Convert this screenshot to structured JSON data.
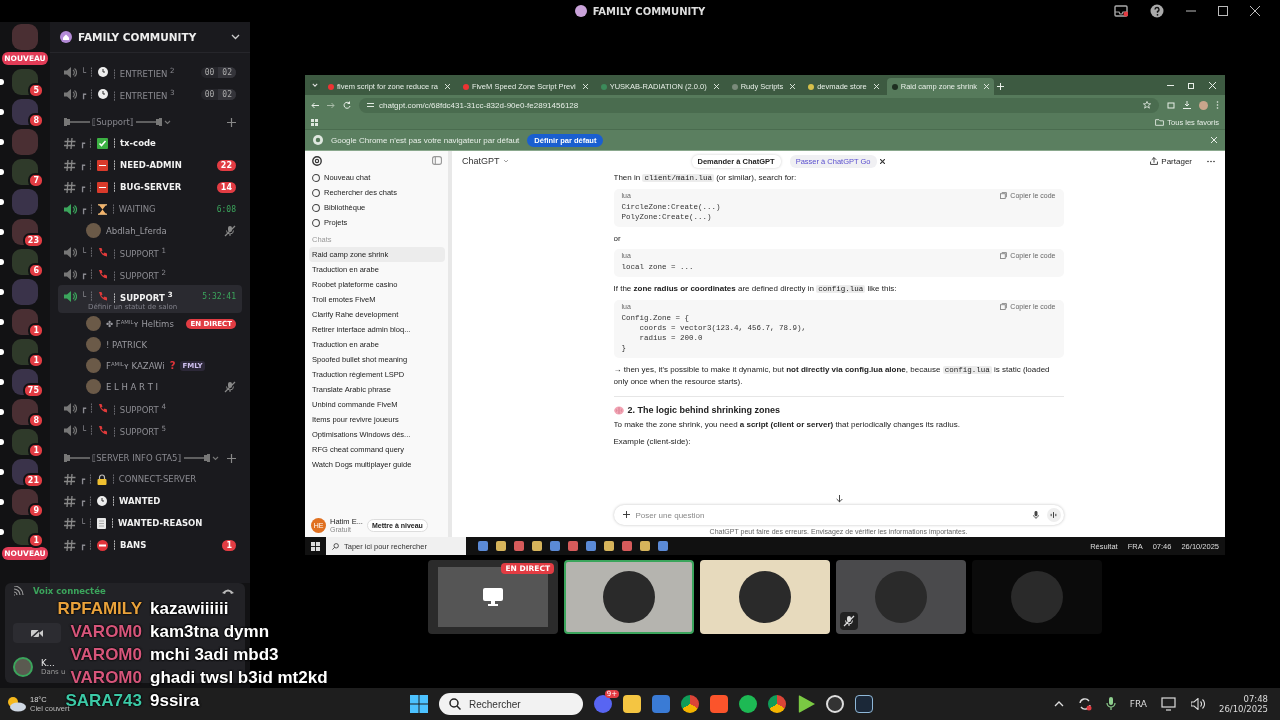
{
  "top_bar": {
    "title": "FAMILY COMMUNITY"
  },
  "servers": [
    {
      "unread": false,
      "pill": "NOUVEAU"
    },
    {
      "unread": true,
      "badge": "5"
    },
    {
      "unread": true,
      "badge": "8"
    },
    {
      "unread": true
    },
    {
      "unread": true,
      "badge": "7"
    },
    {
      "unread": true
    },
    {
      "unread": true,
      "badge": "23"
    },
    {
      "unread": true,
      "badge": "6"
    },
    {
      "unread": true
    },
    {
      "unread": true,
      "badge": "1"
    },
    {
      "unread": true,
      "badge": "1"
    },
    {
      "unread": true,
      "badge": "75"
    },
    {
      "unread": true,
      "badge": "8"
    },
    {
      "unread": true,
      "badge": "1"
    },
    {
      "unread": true,
      "badge": "21"
    },
    {
      "unread": true,
      "badge": "9"
    },
    {
      "unread": true,
      "badge": "1",
      "pill": "NOUVEAU"
    }
  ],
  "server_name": "FAMILY COMMUNITY",
  "channels": [
    {
      "kind": "voice",
      "prefix": "└ ┊",
      "name": "┊ ENTRETIEN $^{2}$",
      "active": false,
      "selected": false,
      "timer": [
        "00",
        "02"
      ]
    },
    {
      "kind": "voice",
      "prefix": "┏ ┊",
      "name": "┊ ENTRETIEN $^{3}$",
      "active": false,
      "selected": false,
      "timer": [
        "00",
        "02"
      ]
    },
    {
      "kind": "category",
      "name": "⟦Support⟧",
      "expanded": true
    },
    {
      "kind": "text",
      "prefix": "┏ ┊",
      "name": "┊ tx-code",
      "unread": true,
      "selected": false
    },
    {
      "kind": "text",
      "prefix": "┏ ┊",
      "name": "┊ NEED-ADMIN",
      "unread": true,
      "selected": false,
      "badge": "22"
    },
    {
      "kind": "text",
      "prefix": "┏ ┊",
      "name": "┊ BUG-SERVER",
      "unread": true,
      "selected": false,
      "badge": "14"
    },
    {
      "kind": "voice",
      "prefix": "┏ ┊",
      "name": "┊ WAITING",
      "active": true,
      "selected": false,
      "time": "6:08"
    },
    {
      "kind": "member",
      "name": "Abdlah_Lferda",
      "muted": true
    },
    {
      "kind": "voice",
      "prefix": "└ ┊",
      "name": "┊ SUPPORT $^{1}$",
      "active": false,
      "selected": false
    },
    {
      "kind": "voice",
      "prefix": "┏ ┊",
      "name": "┊ SUPPORT $^{2}$",
      "active": false,
      "selected": false
    },
    {
      "kind": "voice",
      "prefix": "└ ┊",
      "name": "┊ SUPPORT $^{3}$",
      "active": true,
      "selected": true,
      "time": "5:32:41",
      "status": "Définir un statut de salon"
    },
    {
      "kind": "member",
      "name": "✤ Fᴬᴹᴵᴸʏ Heltims",
      "muted": false,
      "live": "EN DIRECT"
    },
    {
      "kind": "member",
      "name": "! PATRICK",
      "muted": false
    },
    {
      "kind": "member",
      "name": "Fᴬᴹᴵᴸʏ KAZAWi",
      "mark": "?",
      "tag": "FMLY",
      "muted": false
    },
    {
      "kind": "member",
      "name": "E L H A R T I",
      "muted": true
    },
    {
      "kind": "voice",
      "prefix": "┏ ┊",
      "name": "┊ SUPPORT $^{4}$",
      "active": false,
      "selected": false
    },
    {
      "kind": "voice",
      "prefix": "└ ┊",
      "name": "┊ SUPPORT $^{5}$",
      "active": false,
      "selected": false
    },
    {
      "kind": "category",
      "name": "⟦SERVER INFO GTA5⟧",
      "expanded": true
    },
    {
      "kind": "text",
      "prefix": "┏ ┊",
      "name": "┊ CONNECT-SERVER",
      "unread": false,
      "selected": false
    },
    {
      "kind": "text",
      "prefix": "┏ ┊",
      "name": "┊ WANTED",
      "unread": true,
      "selected": false
    },
    {
      "kind": "text",
      "prefix": "└ ┊",
      "name": "┊ WANTED-REASON",
      "unread": true,
      "selected": false
    },
    {
      "kind": "text",
      "prefix": "┏ ┊",
      "name": "┊ BANS",
      "unread": true,
      "selected": false,
      "badge": "1"
    }
  ],
  "voice_panel": {
    "status": "Voix connectée",
    "user": {
      "name": "K...",
      "status": "Dans u"
    }
  },
  "chat_overlay": [
    {
      "author": "RPFAMILY",
      "color": "#e9a23b",
      "text": "kazawiiiiii"
    },
    {
      "author": "VAROM0",
      "color": "#d6557a",
      "text": "kam3tna dymn"
    },
    {
      "author": "VAROM0",
      "color": "#d6557a",
      "text": "mchi 3adi mbd3"
    },
    {
      "author": "VAROM0",
      "color": "#d6557a",
      "text": "ghadi twsl b3id mt2kd"
    },
    {
      "author": "SARA743",
      "color": "#3cc9a6",
      "text": "9ssira"
    }
  ],
  "stream": {
    "browser": {
      "tabs": [
        {
          "title": "fivem script for zone reduce ra",
          "selected": false
        },
        {
          "title": "FiveM Speed Zone Script Previ",
          "selected": false
        },
        {
          "title": "YUSKAB-RADIATION (2.0.0)",
          "selected": false
        },
        {
          "title": "Rudy Scripts",
          "selected": false
        },
        {
          "title": "devmade store",
          "selected": false
        },
        {
          "title": "Raid camp zone shrink",
          "selected": true
        }
      ],
      "url": "chatgpt.com/c/68fdc431-31cc-832d-90e0-fe2891456128",
      "bookmarks": "Tous les favoris",
      "infobar": {
        "text": "Google Chrome n'est pas votre navigateur par défaut",
        "button": "Définir par défaut"
      }
    },
    "chatgpt": {
      "actions": [
        "Nouveau chat",
        "Rechercher des chats",
        "Bibliothèque",
        "Projets"
      ],
      "section": "Chats",
      "chats": [
        {
          "title": "Raid camp zone shrink",
          "selected": true
        },
        {
          "title": "Traduction en arabe",
          "selected": false
        },
        {
          "title": "Roobet plateforme casino",
          "selected": false
        },
        {
          "title": "Troll emotes FiveM",
          "selected": false
        },
        {
          "title": "Clarify Rahe development",
          "selected": false
        },
        {
          "title": "Retirer interface admin bloq...",
          "selected": false
        },
        {
          "title": "Traduction en arabe",
          "selected": false
        },
        {
          "title": "Spoofed bullet shot meaning",
          "selected": false
        },
        {
          "title": "Traduction règlement LSPD",
          "selected": false
        },
        {
          "title": "Translate Arabic phrase",
          "selected": false
        },
        {
          "title": "Unbind commande FiveM",
          "selected": false
        },
        {
          "title": "Items pour revivre joueurs",
          "selected": false
        },
        {
          "title": "Optimisations Windows dés...",
          "selected": false
        },
        {
          "title": "RFG cheat command query",
          "selected": false
        },
        {
          "title": "Watch Dogs multiplayer guide",
          "selected": false
        }
      ],
      "user": {
        "initials": "HE",
        "name": "Hatim E...",
        "plan": "Gratuit",
        "upgrade": "Mettre à niveau"
      },
      "model": "ChatGPT",
      "ask_popup": "Demander à ChatGPT",
      "go_pill": "Passer à ChatGPT Go",
      "share": "Partager",
      "content": [
        {
          "kind": "para",
          "parts": [
            {
              "kind": "text",
              "text": "Then in"
            },
            {
              "kind": "code",
              "text": "client/main.lua"
            },
            {
              "kind": "text",
              "text": "(or similar), search for:"
            }
          ]
        },
        {
          "kind": "code",
          "lang": "lua",
          "copy": "Copier le code",
          "lines": [
            "CircleZone:Create(...)",
            "PolyZone:Create(...)"
          ]
        },
        {
          "kind": "para",
          "parts": [
            {
              "kind": "text",
              "text": "or"
            }
          ]
        },
        {
          "kind": "code",
          "lang": "lua",
          "copy": "Copier le code",
          "lines": [
            "local zone = ..."
          ]
        },
        {
          "kind": "para",
          "parts": [
            {
              "kind": "text",
              "text": "If the **zone radius or coordinates** are defined directly in"
            },
            {
              "kind": "code",
              "text": "config.lua"
            },
            {
              "kind": "text",
              "text": "like this:"
            }
          ]
        },
        {
          "kind": "code",
          "lang": "lua",
          "copy": "Copier le code",
          "lines": [
            "Config.Zone = {",
            "    coords = vector3(123.4, 456.7, 78.9),",
            "    radius = 200.0",
            "}"
          ]
        },
        {
          "kind": "para",
          "parts": [
            {
              "kind": "text",
              "text": "→ then yes, it's possible to make it dynamic, but **not directly via config.lua alone**, because"
            },
            {
              "kind": "code",
              "text": "config.lua"
            },
            {
              "kind": "text",
              "text": "is static (loaded only once when the resource starts)."
            }
          ]
        },
        {
          "kind": "rule"
        },
        {
          "kind": "heading",
          "text": "2. The logic behind shrinking zones"
        },
        {
          "kind": "para",
          "parts": [
            {
              "kind": "text",
              "text": "To make the zone shrink, you need **a script (client or server)** that periodically changes its radius."
            }
          ]
        },
        {
          "kind": "para",
          "parts": [
            {
              "kind": "text",
              "text": "Example (client-side):"
            }
          ]
        }
      ],
      "composer": {
        "placeholder": "Poser une question"
      },
      "disclaimer": "ChatGPT peut faire des erreurs. Envisagez de vérifier les informations importantes."
    },
    "taskbar": {
      "search_placeholder": "Taper ici pour rechercher",
      "result": "Résultat",
      "lang": "FRA",
      "time": "07:46",
      "date": "26/10/2025"
    }
  },
  "tiles": [
    {
      "kind": "stream",
      "live": "EN DIRECT",
      "color": "#2b2b2b",
      "speaking": false,
      "muted": false
    },
    {
      "kind": "avatar",
      "color": "#b5b4af",
      "speaking": true,
      "muted": false
    },
    {
      "kind": "avatar",
      "color": "#e7dabd",
      "speaking": false,
      "muted": false
    },
    {
      "kind": "avatar",
      "color": "#4a4a4c",
      "speaking": false,
      "muted": true
    },
    {
      "kind": "avatar",
      "color": "#0b0b0b",
      "speaking": false,
      "muted": false
    }
  ],
  "taskbar": {
    "weather": {
      "temp": "18°C",
      "condition": "Ciel couvert"
    },
    "search_placeholder": "Rechercher",
    "discord_badge": "9+",
    "lang": "FRA",
    "time": "07:48",
    "date": "26/10/2025"
  }
}
